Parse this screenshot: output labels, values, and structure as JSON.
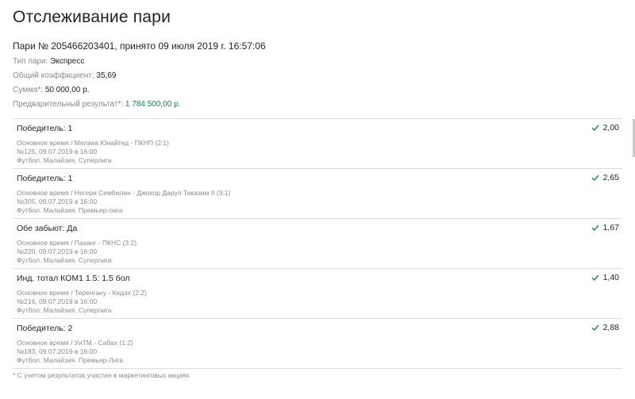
{
  "page": {
    "title": "Отслеживание пари",
    "bet_header": "Пари № 205466203401, принято 09 июля 2019 г. 16:57:06"
  },
  "info": {
    "type_label": "Тип пари:",
    "type_value": "Экспресс",
    "coef_label": "Общий коэффициент:",
    "coef_value": "35,69",
    "sum_label": "Сумма*:",
    "sum_value": "50 000,00 р.",
    "result_label": "Предварительный результат*:",
    "result_value": "1 784 500,00 р."
  },
  "accent_color": "#0b8a5c",
  "status_icon": "check-icon",
  "bets": [
    {
      "title": "Победитель: 1",
      "odds": "2,00",
      "match": "Основное время / Мелака Юнайтед - ПКНП (2:1)",
      "event": "№125, 09.07.2019 в 16:00",
      "league": "Футбол. Малайзия. Суперлига"
    },
    {
      "title": "Победитель: 1",
      "odds": "2,65",
      "match": "Основное время / Негери Сембилан - Джохор Дарул Таказим II (3:1)",
      "event": "№305, 09.07.2019 в 16:00",
      "league": "Футбол. Малайзия. Премьер-лига"
    },
    {
      "title": "Обе забьют: Да",
      "odds": "1,67",
      "match": "Основное время / Паханг - ПКНС (3:2)",
      "event": "№220, 09.07.2019 в 16:00",
      "league": "Футбол. Малайзия. Суперлига"
    },
    {
      "title": "Инд. тотал КОМ1 1.5: 1.5 бол",
      "odds": "1,40",
      "match": "Основное время / Теренгану - Кедах (2:2)",
      "event": "№216, 09.07.2019 в 16:00",
      "league": "Футбол. Малайзия. Суперлига"
    },
    {
      "title": "Победитель: 2",
      "odds": "2,88",
      "match": "Основное время / УиТМ - Сабах (1:2)",
      "event": "№183, 09.07.2019 в 16:00",
      "league": "Футбол. Малайзия. Премьер-Лига"
    }
  ],
  "footnote": "* С учетом результатов участия в маркетинговых акциях"
}
